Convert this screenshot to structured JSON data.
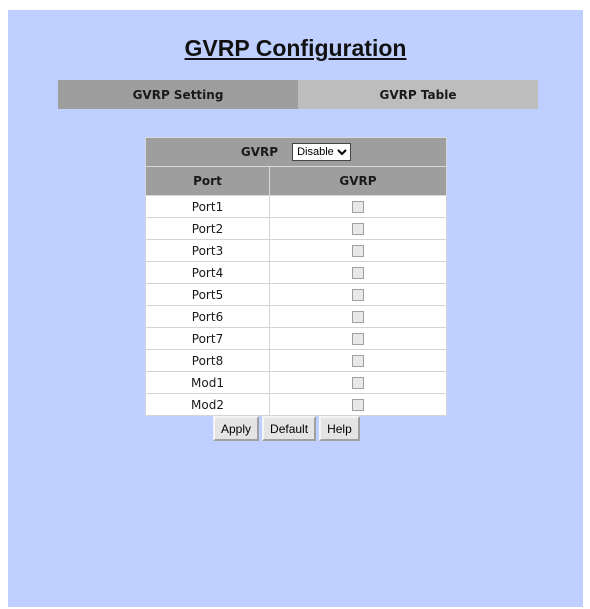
{
  "page": {
    "title": "GVRP Configuration"
  },
  "tabs": [
    {
      "label": "GVRP Setting",
      "active": true
    },
    {
      "label": "GVRP Table",
      "active": false
    }
  ],
  "gvrp": {
    "label": "GVRP",
    "selected": "Disable"
  },
  "table": {
    "headers": [
      "Port",
      "GVRP"
    ],
    "rows": [
      {
        "port": "Port1",
        "checked": false
      },
      {
        "port": "Port2",
        "checked": false
      },
      {
        "port": "Port3",
        "checked": false
      },
      {
        "port": "Port4",
        "checked": false
      },
      {
        "port": "Port5",
        "checked": false
      },
      {
        "port": "Port6",
        "checked": false
      },
      {
        "port": "Port7",
        "checked": false
      },
      {
        "port": "Port8",
        "checked": false
      },
      {
        "port": "Mod1",
        "checked": false
      },
      {
        "port": "Mod2",
        "checked": false
      }
    ]
  },
  "buttons": {
    "apply": "Apply",
    "default": "Default",
    "help": "Help"
  },
  "colors": {
    "background": "#bfcfff",
    "tab_active": "#9e9e9e",
    "tab_inactive": "#bdbdbd",
    "table_header": "#9e9e9e"
  }
}
